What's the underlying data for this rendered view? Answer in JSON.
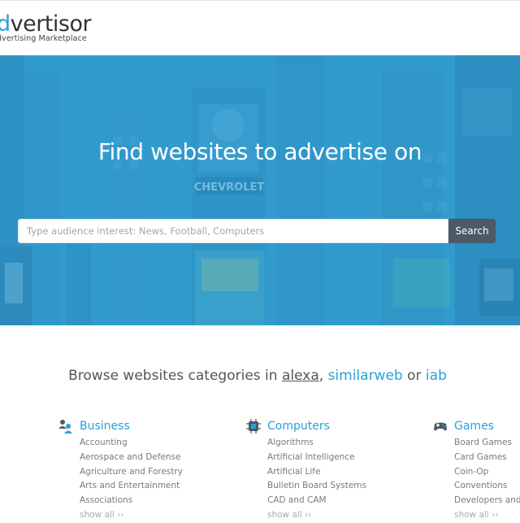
{
  "brand": {
    "logo_accent": "d",
    "logo_rest": "vertisor",
    "tagline": "dvertising Marketplace",
    "accent_color": "#2a9fd8"
  },
  "hero": {
    "title": "Find websites to advertise on",
    "search_placeholder": "Type audience interest: News, Football, Computers",
    "search_button": "Search",
    "background_signs": [
      "CHEVROLET"
    ]
  },
  "browse": {
    "prefix": "Browse websites categories in",
    "alexa": "alexa",
    "sep": ",",
    "similarweb": "similarweb",
    "or": "or",
    "iab": "iab"
  },
  "categories": [
    {
      "title": "Business",
      "icon": "business-people-icon",
      "items": [
        "Accounting",
        "Aerospace and Defense",
        "Agriculture and Forestry",
        "Arts and Entertainment",
        "Associations"
      ],
      "more": "show all ››"
    },
    {
      "title": "Computers",
      "icon": "chip-icon",
      "items": [
        "Algorithms",
        "Artificial Intelligence",
        "Artificial Life",
        "Bulletin Board Systems",
        "CAD and CAM"
      ],
      "more": "show all ››"
    },
    {
      "title": "Games",
      "icon": "gamepad-icon",
      "items": [
        "Board Games",
        "Card Games",
        "Coin-Op",
        "Conventions",
        "Developers and P"
      ],
      "more": "show all ››"
    }
  ]
}
